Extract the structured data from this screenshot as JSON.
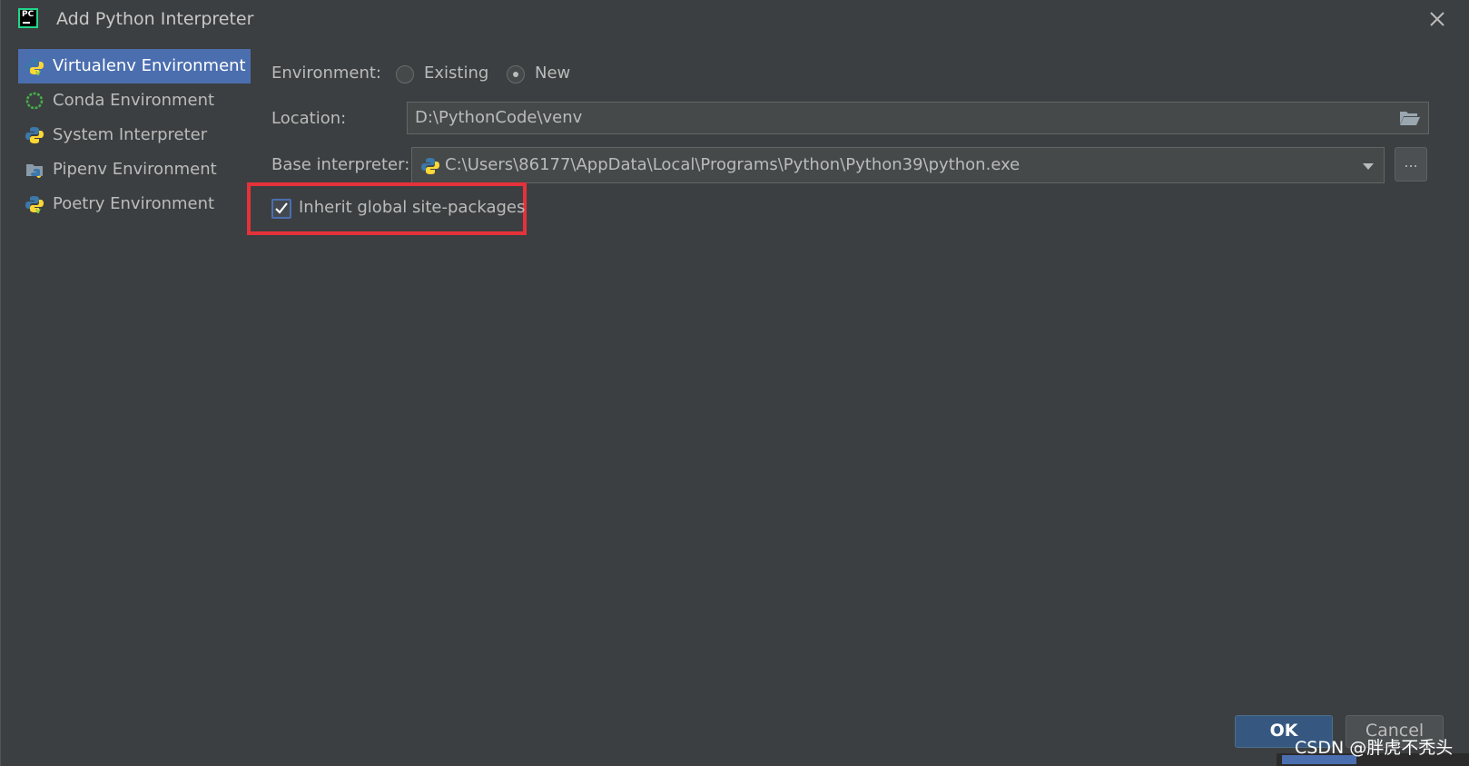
{
  "window": {
    "title": "Add Python Interpreter",
    "app_icon_text": "PC"
  },
  "sidebar": {
    "items": [
      {
        "label": "Virtualenv Environment",
        "icon": "python-virtualenv-icon",
        "selected": true
      },
      {
        "label": "Conda Environment",
        "icon": "conda-icon",
        "selected": false
      },
      {
        "label": "System Interpreter",
        "icon": "python-icon",
        "selected": false
      },
      {
        "label": "Pipenv Environment",
        "icon": "pipenv-icon",
        "selected": false
      },
      {
        "label": "Poetry Environment",
        "icon": "poetry-icon",
        "selected": false
      }
    ]
  },
  "form": {
    "environment_label": "Environment:",
    "environment_options": [
      {
        "label": "Existing",
        "checked": false
      },
      {
        "label": "New",
        "checked": true
      }
    ],
    "location_label": "Location:",
    "location_value": "D:\\PythonCode\\venv",
    "base_interpreter_label": "Base interpreter:",
    "base_interpreter_value": "C:\\Users\\86177\\AppData\\Local\\Programs\\Python\\Python39\\python.exe",
    "browse_label": "...",
    "inherit_label": "Inherit global site-packages",
    "inherit_checked": true
  },
  "buttons": {
    "ok": "OK",
    "cancel": "Cancel"
  },
  "watermark": "CSDN @胖虎不秃头",
  "colors": {
    "background": "#3c3f41",
    "selection": "#4b6eaf",
    "highlight_box": "#e5323a",
    "ok_button": "#365880"
  }
}
